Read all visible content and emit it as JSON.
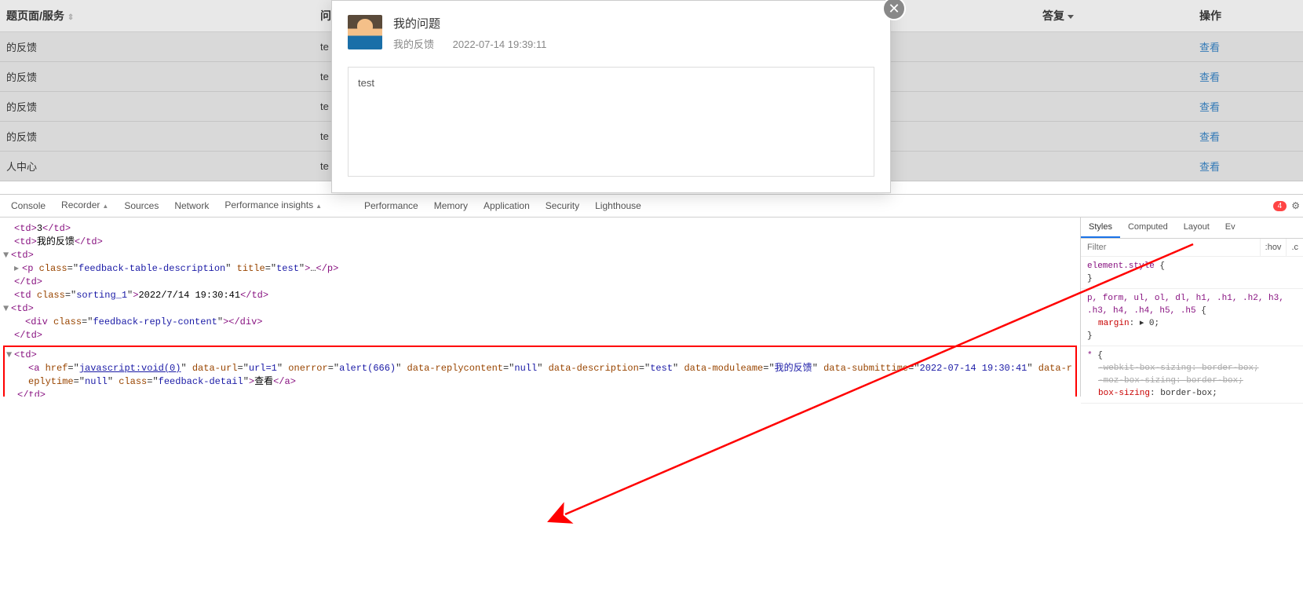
{
  "table": {
    "headers": {
      "page": "题页面/服务",
      "q": "问",
      "reply": "答复",
      "op": "操作"
    },
    "rows": [
      {
        "page": "的反馈",
        "q": "te",
        "op": "查看"
      },
      {
        "page": "的反馈",
        "q": "te",
        "op": "查看"
      },
      {
        "page": "的反馈",
        "q": "te",
        "op": "查看"
      },
      {
        "page": "的反馈",
        "q": "te",
        "op": "查看"
      },
      {
        "page": "人中心",
        "q": "te",
        "op": "查看"
      }
    ]
  },
  "modal": {
    "title": "我的问题",
    "source": "我的反馈",
    "time": "2022-07-14 19:39:11",
    "body": "test"
  },
  "devtools_tabs": [
    "Console",
    "Recorder",
    "Sources",
    "Network",
    "Performance insights",
    "Performance",
    "Memory",
    "Application",
    "Security",
    "Lighthouse"
  ],
  "error_count": "4",
  "dom": {
    "l1": "3",
    "l2": "我的反馈",
    "p_class": "feedback-table-description",
    "p_title": "test",
    "sort_class": "sorting_1",
    "sort_text": "2022/7/14 19:30:41",
    "reply_class": "feedback-reply-content",
    "a_href": "javascript:void(0)",
    "a_dataurl": "url=1",
    "a_onerror": "alert(666)",
    "a_replycontent": "null",
    "a_desc": "test",
    "a_module": "我的反馈",
    "a_submit": "2022-07-14 19:30:41",
    "a_replytime": "null",
    "a_class": "feedback-detail",
    "a_text": "查看"
  },
  "styles": {
    "tabs": [
      "Styles",
      "Computed",
      "Layout",
      "Ev"
    ],
    "filter_ph": "Filter",
    "hov": ":hov",
    "cls": ".c",
    "r1_sel": "element.style",
    "r2_sel": "p, form, ul, ol, dl, h1, .h1, .h2, h3, .h3, h4, .h4, h5, .h5",
    "r2_prop": "margin",
    "r2_val": "▸ 0",
    "r3_sel": "*",
    "r3_p1": "-webkit-box-sizing",
    "r3_v1": "border-box",
    "r3_p2": "-moz-box-sizing",
    "r3_v2": "border-box",
    "r3_p3": "box-sizing",
    "r3_v3": "border-box"
  }
}
